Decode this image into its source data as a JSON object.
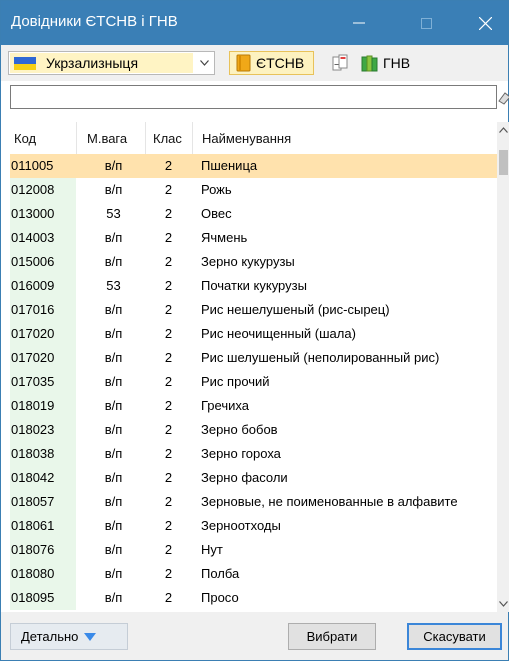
{
  "window": {
    "title": "Довідники ЄТСНВ і ГНВ",
    "colors": {
      "titlebar": "#3a7fb6",
      "selected_row": "#ffe2ad",
      "code_column": "#e9f7ea"
    }
  },
  "toolbar": {
    "railway": {
      "selected": "Укрзализныця",
      "flag_icon": "ukraine-flag-icon"
    },
    "etsnv_label": "ЄТСНВ",
    "gnv_label": "ГНВ"
  },
  "search": {
    "value": "",
    "placeholder": ""
  },
  "table": {
    "columns": [
      "Код",
      "М.вага",
      "Клас",
      "Найменування"
    ],
    "rows": [
      {
        "code": "011005",
        "mass": "в/п",
        "class": "2",
        "name": "Пшеница",
        "selected": true
      },
      {
        "code": "012008",
        "mass": "в/п",
        "class": "2",
        "name": "Рожь"
      },
      {
        "code": "013000",
        "mass": "53",
        "class": "2",
        "name": "Овес"
      },
      {
        "code": "014003",
        "mass": "в/п",
        "class": "2",
        "name": "Ячмень"
      },
      {
        "code": "015006",
        "mass": "в/п",
        "class": "2",
        "name": "Зерно кукурузы"
      },
      {
        "code": "016009",
        "mass": "53",
        "class": "2",
        "name": "Початки кукурузы"
      },
      {
        "code": "017016",
        "mass": "в/п",
        "class": "2",
        "name": "Рис нешелушеный (рис-сырец)"
      },
      {
        "code": "017020",
        "mass": "в/п",
        "class": "2",
        "name": "Рис неочищенный (шала)"
      },
      {
        "code": "017020",
        "mass": "в/п",
        "class": "2",
        "name": "Рис шелушеный (неполированный рис)"
      },
      {
        "code": "017035",
        "mass": "в/п",
        "class": "2",
        "name": "Рис прочий"
      },
      {
        "code": "018019",
        "mass": "в/п",
        "class": "2",
        "name": "Гречиха"
      },
      {
        "code": "018023",
        "mass": "в/п",
        "class": "2",
        "name": "Зерно бобов"
      },
      {
        "code": "018038",
        "mass": "в/п",
        "class": "2",
        "name": "Зерно гороха"
      },
      {
        "code": "018042",
        "mass": "в/п",
        "class": "2",
        "name": "Зерно фасоли"
      },
      {
        "code": "018057",
        "mass": "в/п",
        "class": "2",
        "name": "Зерновые, не поименованные в алфавите"
      },
      {
        "code": "018061",
        "mass": "в/п",
        "class": "2",
        "name": "Зерноотходы"
      },
      {
        "code": "018076",
        "mass": "в/п",
        "class": "2",
        "name": "Нут"
      },
      {
        "code": "018080",
        "mass": "в/п",
        "class": "2",
        "name": "Полба"
      },
      {
        "code": "018095",
        "mass": "в/п",
        "class": "2",
        "name": "Просо"
      }
    ]
  },
  "footer": {
    "details_label": "Детально",
    "select_label": "Вибрати",
    "cancel_label": "Скасувати"
  }
}
